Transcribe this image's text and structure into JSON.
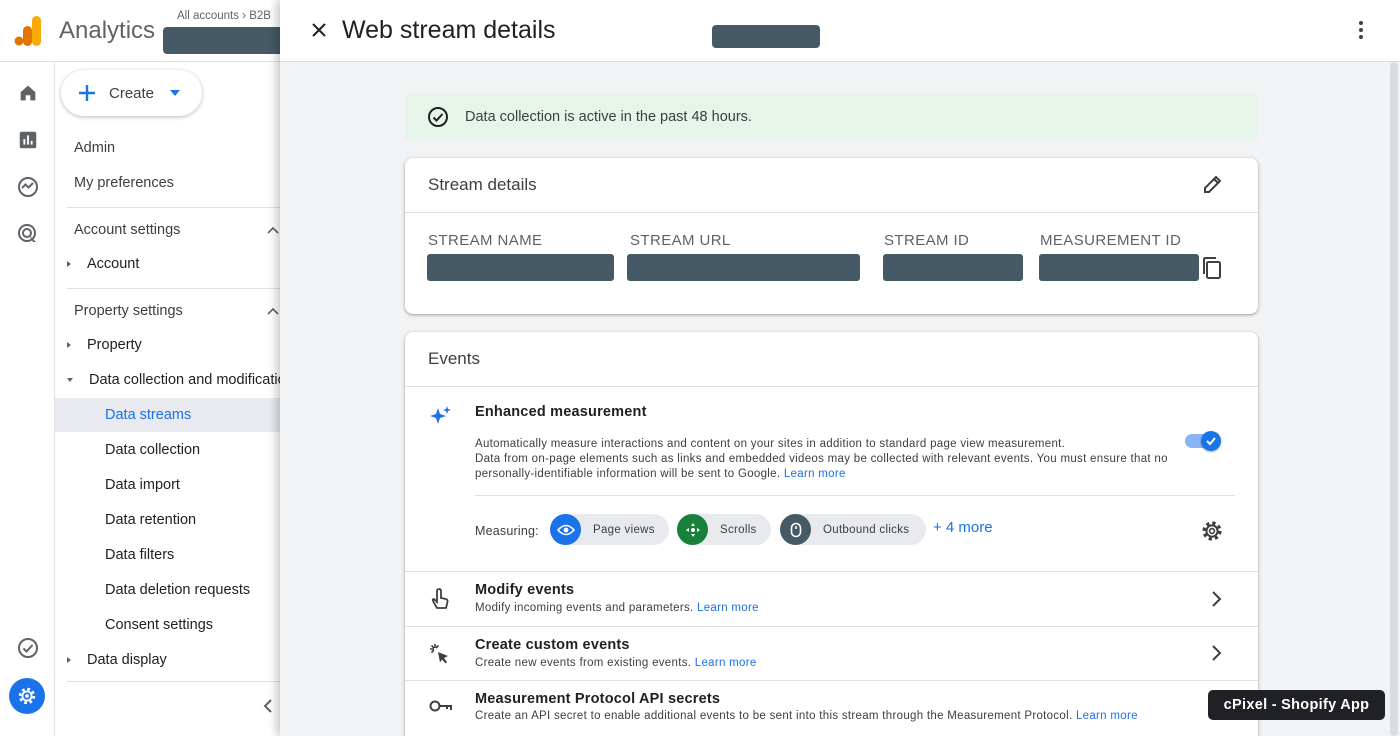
{
  "header": {
    "app_name": "Analytics",
    "accounts_breadcrumb": "All accounts  ›  B2B"
  },
  "nav": {
    "create_label": "Create",
    "admin": "Admin",
    "my_preferences": "My preferences",
    "account_settings": "Account settings",
    "account": "Account",
    "property_settings": "Property settings",
    "property": "Property",
    "data_collection_mod": "Data collection and modifications",
    "items": [
      {
        "label": "Data streams",
        "selected": true
      },
      {
        "label": "Data collection",
        "selected": false
      },
      {
        "label": "Data import",
        "selected": false
      },
      {
        "label": "Data retention",
        "selected": false
      },
      {
        "label": "Data filters",
        "selected": false
      },
      {
        "label": "Data deletion requests",
        "selected": false
      },
      {
        "label": "Consent settings",
        "selected": false
      }
    ],
    "data_display": "Data display"
  },
  "panel": {
    "title": "Web stream details",
    "banner": "Data collection is active in the past 48 hours.",
    "stream_details": {
      "heading": "Stream details",
      "fields": [
        "STREAM NAME",
        "STREAM URL",
        "STREAM ID",
        "MEASUREMENT ID"
      ]
    },
    "events": {
      "heading": "Events",
      "enhanced": {
        "title": "Enhanced measurement",
        "desc1": "Automatically measure interactions and content on your sites in addition to standard page view measurement.",
        "desc2": "Data from on-page elements such as links and embedded videos may be collected with relevant events. You must ensure that no",
        "desc3": "personally-identifiable information will be sent to Google.",
        "learn_more": "Learn more",
        "enabled": true,
        "measuring_label": "Measuring:",
        "chips": [
          "Page views",
          "Scrolls",
          "Outbound clicks"
        ],
        "more": "+ 4 more"
      },
      "modify": {
        "title": "Modify events",
        "desc": "Modify incoming events and parameters.",
        "learn_more": "Learn more"
      },
      "custom": {
        "title": "Create custom events",
        "desc": "Create new events from existing events.",
        "learn_more": "Learn more"
      },
      "mp_secrets": {
        "title": "Measurement Protocol API secrets",
        "desc": "Create an API secret to enable additional events to be sent into this stream through the Measurement Protocol.",
        "learn_more": "Learn more"
      }
    }
  },
  "badge": "cPixel - Shopify App",
  "colors": {
    "accent": "#1a73e8",
    "success_bg": "#e6f4ea",
    "redaction": "#455a64",
    "chip_green": "#188038"
  },
  "icons": {
    "home": "home-icon",
    "reports": "bar-chart-icon",
    "explore": "explore-icon",
    "advertising": "target-icon",
    "settings": "gear-icon"
  }
}
